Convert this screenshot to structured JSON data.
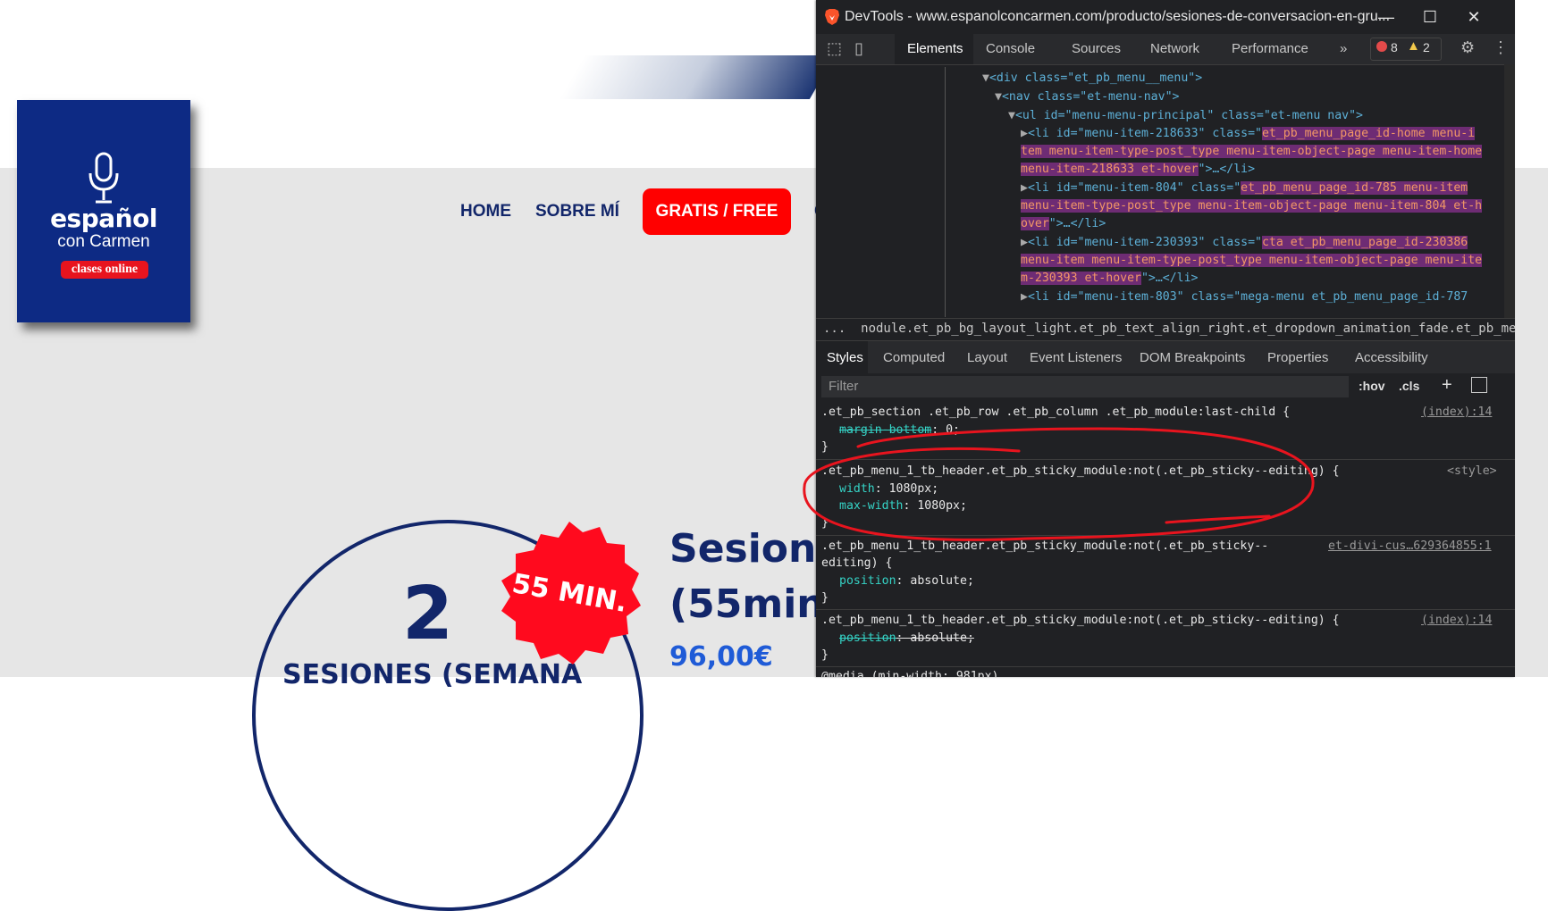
{
  "site": {
    "logo": {
      "line1": "español",
      "line2": "con Carmen",
      "line3": "clases online"
    },
    "nav": {
      "home": "HOME",
      "sobre": "SOBRE MÍ",
      "cta": "GRATIS / FREE",
      "cut": "C"
    },
    "badge": "55 MIN.",
    "big_number": "2",
    "sessions_text": "SESIONES (SEMANA",
    "title_line1": "Sesione",
    "title_line2": "(55min",
    "price": "96,00€",
    "colors": {
      "navy": "#12266a",
      "red": "#ff0000",
      "price_blue": "#1f5bd7"
    }
  },
  "devtools": {
    "window_title": "DevTools - www.espanolconcarmen.com/producto/sesiones-de-conversacion-en-gru...",
    "tabs": [
      "Elements",
      "Console",
      "Sources",
      "Network",
      "Performance"
    ],
    "more_tabs": "»",
    "errors": "8",
    "warnings": "2",
    "dom": {
      "l1_text": "<div class=\"et_pb_menu__menu\">",
      "l2_text": "<nav class=\"et-menu-nav\">",
      "l3_text": "<ul id=\"menu-menu-principal\" class=\"et-menu nav\">",
      "li1_open": "<li id=\"menu-item-218633\" class=\"",
      "li1_cls_a": "et_pb_menu_page_id-home menu-i",
      "li1_cls_b": "tem menu-item-type-post_type menu-item-object-page menu-item-home",
      "li1_cls_c": "menu-item-218633 et-hover",
      "li1_close": "\">…</li>",
      "li2_open": "<li id=\"menu-item-804\" class=\"",
      "li2_cls_a": "et_pb_menu_page_id-785 menu-item",
      "li2_cls_b": "menu-item-type-post_type menu-item-object-page menu-item-804 et-h",
      "li2_cls_c": "over",
      "li2_close": "\">…</li>",
      "li3_open": "<li id=\"menu-item-230393\" class=\"",
      "li3_cls_a": "cta et_pb_menu_page_id-230386",
      "li3_cls_b": "menu-item menu-item-type-post_type menu-item-object-page menu-ite",
      "li3_cls_c": "m-230393 et-hover",
      "li3_close": "\">…</li>",
      "li4_text": "<li id=\"menu-item-803\" class=\"mega-menu et_pb_menu_page_id-787"
    },
    "breadcrumb": "...  nodule.et_pb_bg_layout_light.et_pb_text_align_right.et_dropdown_animation_fade.et_pb_menu--with-logo.et  ...",
    "subtabs": [
      "Styles",
      "Computed",
      "Layout",
      "Event Listeners",
      "DOM Breakpoints",
      "Properties",
      "Accessibility"
    ],
    "filter_placeholder": "Filter",
    "hov": ":hov",
    "cls": ".cls",
    "rules": {
      "r0_sel": ".et_pb_section .et_pb_row .et_pb_column .et_pb_module:last-child {",
      "r0_prop": "margin-bottom",
      "r0_val": "0;",
      "r0_src": "(index):14",
      "r1_sel": ".et_pb_menu_1_tb_header.et_pb_sticky_module:not(.et_pb_sticky--editing) {",
      "r1_src": "<style>",
      "r1_p1": "width",
      "r1_v1": "1080px;",
      "r1_p2": "max-width",
      "r1_v2": "1080px;",
      "r2_sel1": ".et_pb_menu_1_tb_header.et_pb_sticky_module:not(.et_pb_sticky--",
      "r2_sel2": "editing) {",
      "r2_src": "et-divi-cus…629364855:1",
      "r2_prop": "position",
      "r2_val": "absolute;",
      "r3_sel": ".et_pb_menu_1_tb_header.et_pb_sticky_module:not(.et_pb_sticky--editing) {",
      "r3_src": "(index):14",
      "r3_prop": "position",
      "r3_val": "absolute;",
      "close": "}",
      "media": "@media (min-width: 981px)"
    }
  }
}
